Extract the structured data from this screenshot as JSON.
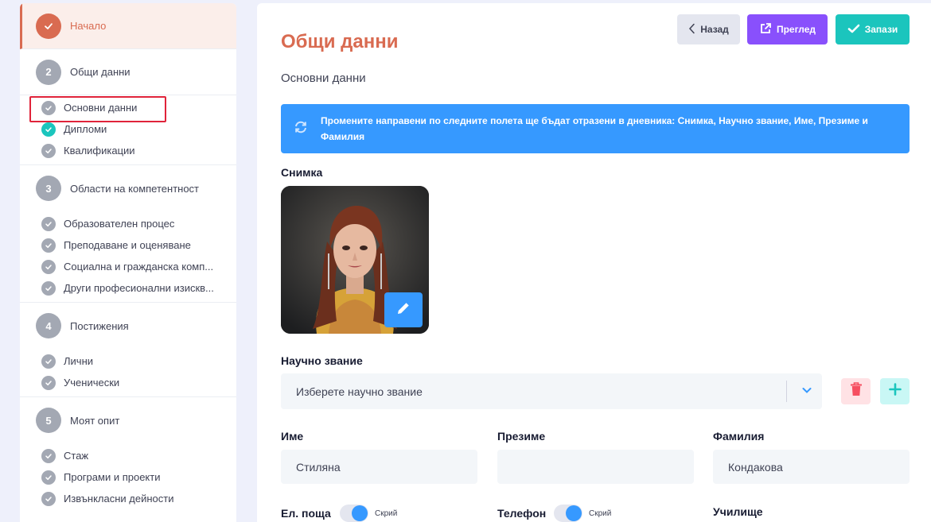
{
  "sidebar": {
    "steps": [
      {
        "num": "",
        "label": "Начало"
      },
      {
        "num": "2",
        "label": "Общи данни",
        "items": [
          "Основни данни",
          "Дипломи",
          "Квалификации"
        ]
      },
      {
        "num": "3",
        "label": "Области на компетентност",
        "items": [
          "Образователен процес",
          "Преподаване и оценяване",
          "Социална и гражданска комп...",
          "Други професионални изискв..."
        ]
      },
      {
        "num": "4",
        "label": "Постижения",
        "items": [
          "Лични",
          "Ученически"
        ]
      },
      {
        "num": "5",
        "label": "Моят опит",
        "items": [
          "Стаж",
          "Програми и проекти",
          "Извънкласни дейности"
        ]
      }
    ]
  },
  "header": {
    "title": "Общи данни",
    "subtitle": "Основни данни",
    "back_label": "Назад",
    "preview_label": "Преглед",
    "save_label": "Запази"
  },
  "alert": {
    "text": "Промените направени по следните полета ще бъдат отразени в дневника: ",
    "fields": "Снимка, Научно звание, Име, Презиме и Фамилия"
  },
  "form": {
    "photo_label": "Снимка",
    "degree_label": "Научно звание",
    "degree_placeholder": "Изберете научно звание",
    "first_name_label": "Име",
    "first_name_value": "Стиляна",
    "middle_name_label": "Презиме",
    "middle_name_value": "",
    "last_name_label": "Фамилия",
    "last_name_value": "Кондакова",
    "email_label": "Ел. поща",
    "phone_label": "Телефон",
    "school_label": "Училище",
    "hide_label": "Скрий"
  },
  "colors": {
    "accent": "#d96b51",
    "primary": "#3699ff",
    "purple": "#8950fc",
    "success": "#1bc5bd",
    "danger": "#f64e60"
  },
  "icons": {
    "back": "chevron-left-icon",
    "preview": "external-link-icon",
    "save": "check-icon",
    "alert": "sync-icon",
    "edit": "pencil-icon",
    "delete": "trash-icon",
    "add": "plus-icon"
  }
}
